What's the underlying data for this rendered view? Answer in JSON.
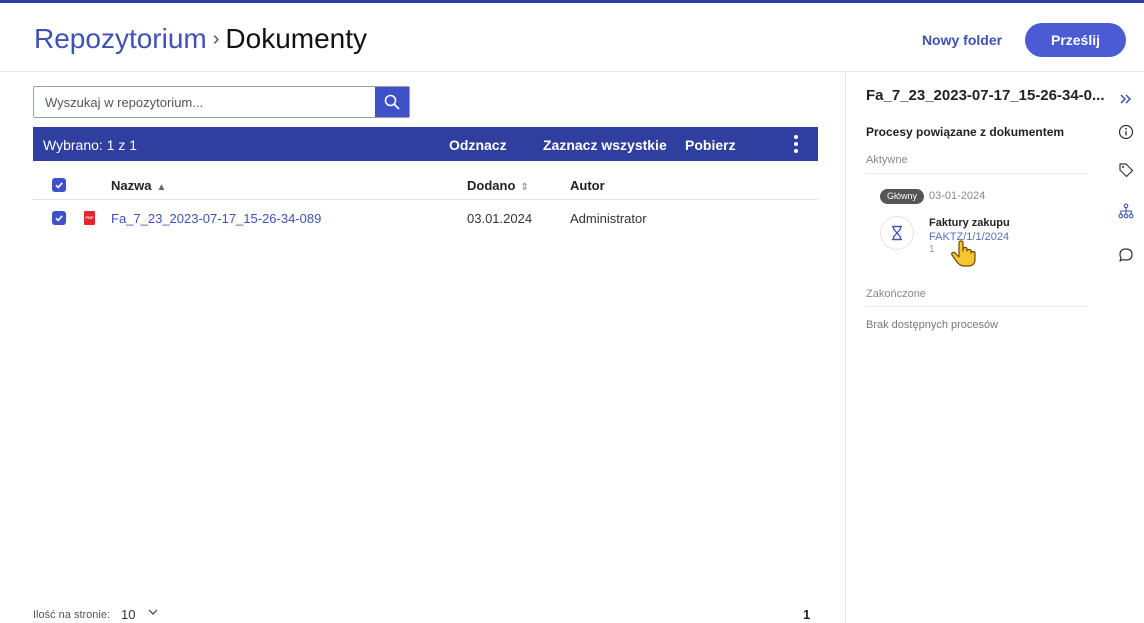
{
  "breadcrumb": {
    "root": "Repozytorium",
    "separator": "›",
    "current": "Dokumenty"
  },
  "header": {
    "new_folder_label": "Nowy folder",
    "upload_label": "Prześlij"
  },
  "search": {
    "placeholder": "Wyszukaj w repozytorium...",
    "value": ""
  },
  "selection_bar": {
    "count_label": "Wybrano: 1 z 1",
    "deselect_label": "Odznacz",
    "select_all_label": "Zaznacz wszystkie",
    "download_label": "Pobierz"
  },
  "table": {
    "columns": {
      "name": "Nazwa",
      "added": "Dodano",
      "author": "Autor"
    },
    "rows": [
      {
        "name": "Fa_7_23_2023-07-17_15-26-34-089",
        "added": "03.01.2024",
        "author": "Administrator",
        "file_type": "PDF",
        "checked": true
      }
    ]
  },
  "pagination": {
    "per_page_label": "Ilość na stronie:",
    "per_page_value": "10",
    "current_page": "1"
  },
  "details": {
    "document_title": "Fa_7_23_2023-07-17_15-26-34-0...",
    "processes_title": "Procesy powiązane z dokumentem",
    "active_label": "Aktywne",
    "process": {
      "badge": "Główny",
      "date": "03-01-2024",
      "name": "Faktury zakupu",
      "number": "FAKTZ/1/1/2024",
      "step": "1"
    },
    "finished_label": "Zakończone",
    "empty_message": "Brak dostępnych procesów"
  },
  "icons": [
    "search-icon",
    "pdf-file-icon",
    "more-vertical-icon",
    "chevron-down-icon",
    "collapse-panel-icon",
    "info-icon",
    "tag-icon",
    "process-tree-icon",
    "comment-icon",
    "hourglass-icon",
    "hand-pointer-icon"
  ],
  "colors": {
    "accent": "#3f51b5",
    "selection_bar": "#2f3fa0",
    "primary_button": "#4a5bd4"
  }
}
